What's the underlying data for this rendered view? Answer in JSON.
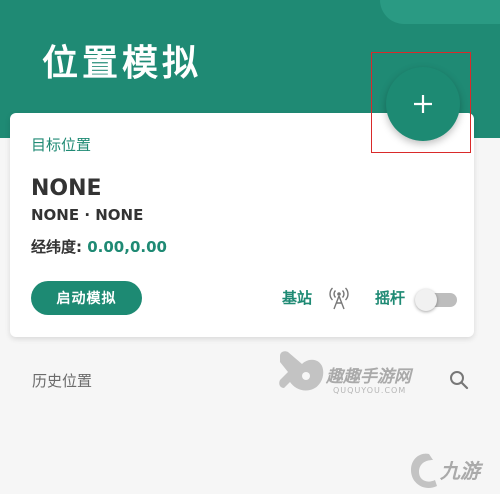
{
  "header": {
    "title": "位置模拟",
    "add_button_icon": "plus-icon"
  },
  "card": {
    "section_label": "目标位置",
    "place_name": "NONE",
    "place_detail": "NONE · NONE",
    "coord_label": "经纬度:",
    "coord_value": "0.00,0.00",
    "start_button_label": "启动模拟",
    "base_station_label": "基站",
    "base_station_icon": "antenna-icon",
    "joystick_label": "摇杆",
    "joystick_enabled": false
  },
  "history": {
    "label": "历史位置",
    "search_icon": "search-icon"
  },
  "watermarks": {
    "site_name": "趣趣手游网",
    "site_url": "QUQUYOU.COM",
    "brand2": "九游"
  },
  "colors": {
    "accent": "#1f8a74",
    "highlight": "#d92a2a"
  }
}
